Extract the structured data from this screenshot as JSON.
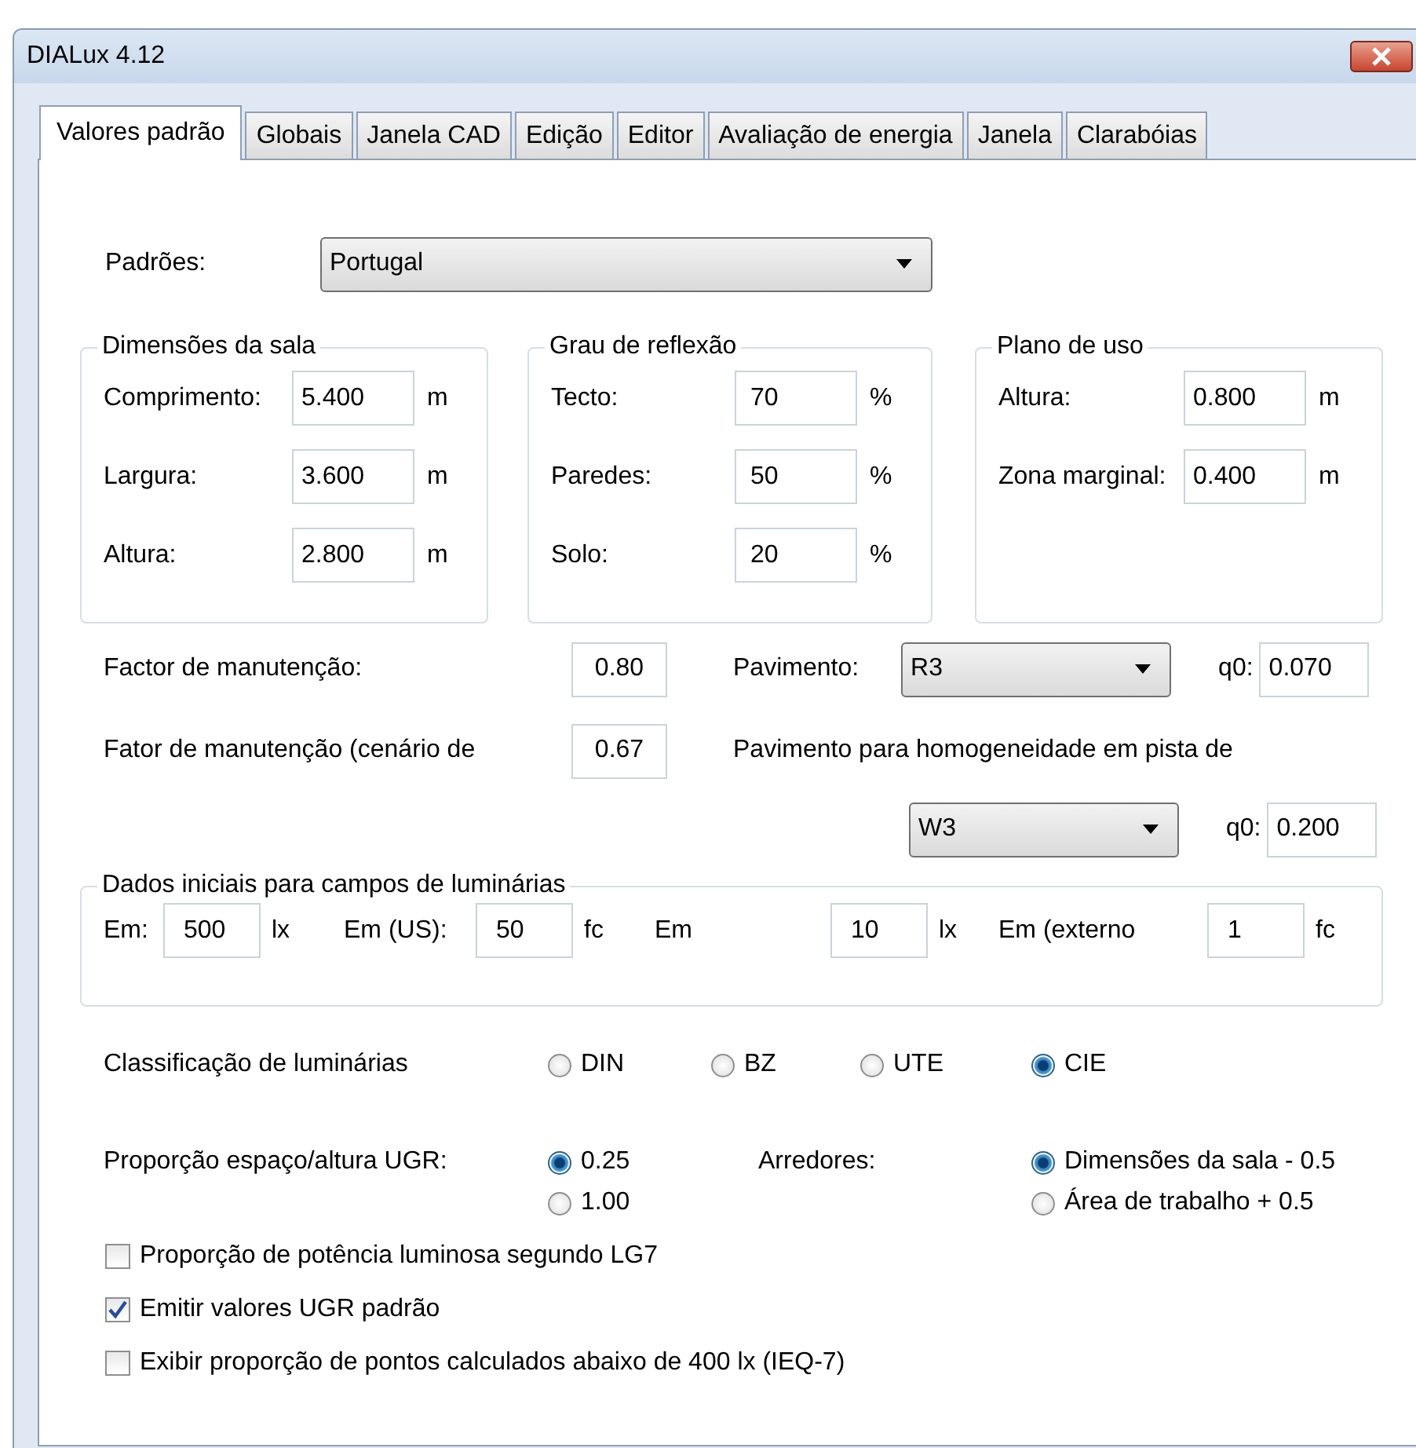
{
  "window": {
    "title": "DIALux 4.12"
  },
  "tabs": [
    {
      "label": "Valores padrão",
      "selected": true
    },
    {
      "label": "Globais",
      "selected": false
    },
    {
      "label": "Janela CAD",
      "selected": false
    },
    {
      "label": "Edição",
      "selected": false
    },
    {
      "label": "Editor",
      "selected": false
    },
    {
      "label": "Avaliação de energia",
      "selected": false
    },
    {
      "label": "Janela",
      "selected": false
    },
    {
      "label": "Clarabóias",
      "selected": false
    }
  ],
  "standards": {
    "label": "Padrões:",
    "value": "Portugal"
  },
  "groups": [
    {
      "title": "Dimensões da sala",
      "fields": [
        {
          "label": "Comprimento:",
          "value": "5.400",
          "unit": "m"
        },
        {
          "label": "Largura:",
          "value": "3.600",
          "unit": "m"
        },
        {
          "label": "Altura:",
          "value": "2.800",
          "unit": "m"
        }
      ]
    },
    {
      "title": "Grau de reflexão",
      "fields": [
        {
          "label": "Tecto:",
          "value": "70",
          "unit": "%"
        },
        {
          "label": "Paredes:",
          "value": "50",
          "unit": "%"
        },
        {
          "label": "Solo:",
          "value": "20",
          "unit": "%"
        }
      ]
    },
    {
      "title": "Plano de uso",
      "fields": [
        {
          "label": "Altura:",
          "value": "0.800",
          "unit": "m"
        },
        {
          "label": "Zona marginal:",
          "value": "0.400",
          "unit": "m"
        }
      ]
    }
  ],
  "maintenance_rows": [
    {
      "label": "Factor de manutenção:",
      "value": "0.80",
      "pavement_label": "Pavimento:"
    },
    {
      "label": "Fator de manutenção (cenário de",
      "value": "0.67",
      "pavement_label": "Pavimento para homogeneidade em pista de"
    }
  ],
  "pavements": [
    {
      "value": "R3",
      "q0_label": "q0:",
      "q0": "0.070"
    },
    {
      "value": "W3",
      "q0_label": "q0:",
      "q0": "0.200"
    }
  ],
  "initial_data": {
    "title": "Dados iniciais para campos de luminárias",
    "fields": [
      {
        "label": "Em:",
        "value": "500",
        "unit": "lx"
      },
      {
        "label": "Em (US):",
        "value": "50",
        "unit": "fc"
      },
      {
        "label": "Em",
        "value": "10",
        "unit": "lx"
      },
      {
        "label": "Em (externo",
        "value": "1",
        "unit": "fc"
      }
    ]
  },
  "classification": {
    "label": "Classificação de luminárias",
    "options": [
      {
        "label": "DIN",
        "selected": false
      },
      {
        "label": "BZ",
        "selected": false
      },
      {
        "label": "UTE",
        "selected": false
      },
      {
        "label": "CIE",
        "selected": true
      }
    ]
  },
  "ugr": {
    "label": "Proporção espaço/altura UGR:",
    "options": [
      {
        "label": "0.25",
        "selected": true
      },
      {
        "label": "1.00",
        "selected": false
      }
    ]
  },
  "surroundings": {
    "label": "Arredores:",
    "options": [
      {
        "label": "Dimensões da sala - 0.5",
        "selected": true
      },
      {
        "label": "Área de trabalho + 0.5",
        "selected": false
      }
    ]
  },
  "checkboxes": [
    {
      "label": "Proporção de potência luminosa segundo LG7",
      "checked": false
    },
    {
      "label": "Emitir valores UGR padrão",
      "checked": true
    },
    {
      "label": "Exibir proporção de pontos calculados abaixo de 400 lx (IEQ-7)",
      "checked": false
    }
  ]
}
